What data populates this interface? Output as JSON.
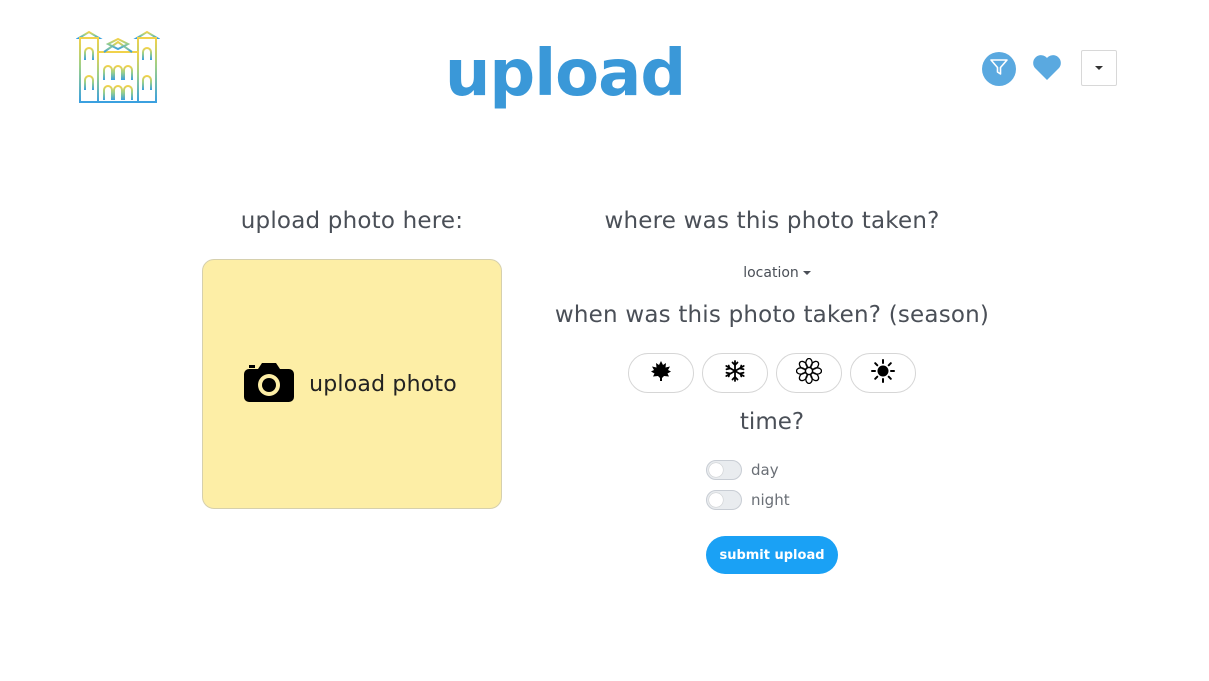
{
  "header": {
    "title": "upload",
    "logo_icon": "university-building-icon",
    "filter_icon": "filter-icon",
    "favorites_icon": "heart-icon",
    "menu_icon": "caret-down-icon"
  },
  "upload": {
    "heading": "upload photo here:",
    "button_label": "upload photo",
    "button_icon": "camera-icon",
    "box_color": "#fdeea6"
  },
  "location": {
    "heading": "where was this photo taken?",
    "dropdown_label": "location"
  },
  "season": {
    "heading": "when was this photo taken? (season)",
    "options": [
      {
        "icon": "leaf-icon",
        "glyph": "🍁"
      },
      {
        "icon": "snowflake-icon",
        "glyph": "❄"
      },
      {
        "icon": "flower-icon",
        "glyph": "❁"
      },
      {
        "icon": "sun-icon",
        "glyph": "☀"
      }
    ]
  },
  "time": {
    "heading": "time?",
    "options": [
      {
        "label": "day",
        "checked": false
      },
      {
        "label": "night",
        "checked": false
      }
    ]
  },
  "submit": {
    "label": "submit upload"
  },
  "colors": {
    "accent": "#3a98d8",
    "submit": "#1aa1f5",
    "text": "#4a4f57"
  }
}
